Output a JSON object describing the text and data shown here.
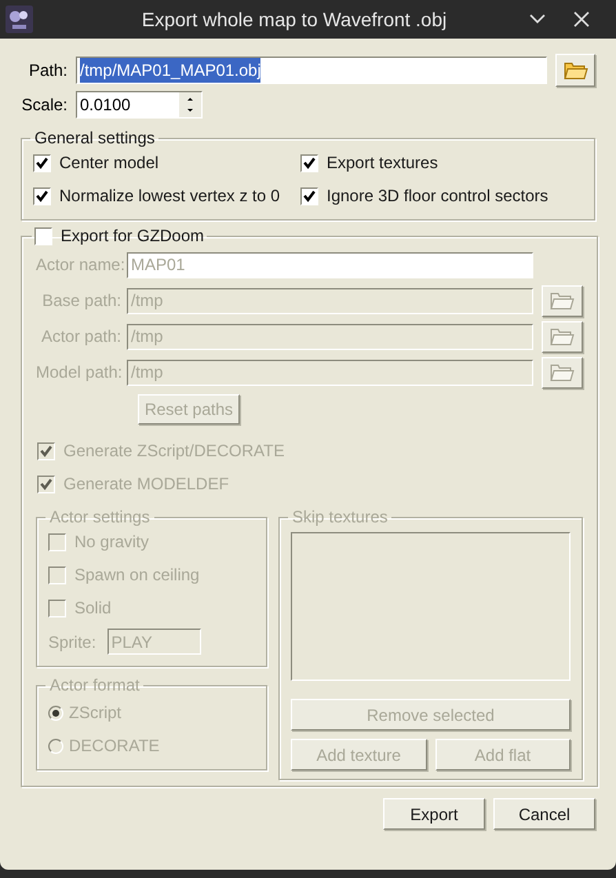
{
  "window": {
    "title": "Export whole map to Wavefront .obj"
  },
  "path": {
    "label": "Path:",
    "value": "/tmp/MAP01_MAP01.obj",
    "selected": true
  },
  "scale": {
    "label": "Scale:",
    "value": "0.0100"
  },
  "general_settings": {
    "title": "General settings",
    "options": [
      {
        "label": "Center model",
        "checked": true
      },
      {
        "label": "Export textures",
        "checked": true
      },
      {
        "label": "Normalize lowest vertex z to 0",
        "checked": true
      },
      {
        "label": "Ignore 3D floor control sectors",
        "checked": true
      }
    ]
  },
  "gzdoom": {
    "label": "Export for GZDoom",
    "checked": false,
    "fields": [
      {
        "label": "Actor name:",
        "value": "MAP01",
        "kind": "text"
      },
      {
        "label": "Base path:",
        "value": "/tmp",
        "kind": "path"
      },
      {
        "label": "Actor path:",
        "value": "/tmp",
        "kind": "path"
      },
      {
        "label": "Model path:",
        "value": "/tmp",
        "kind": "path"
      }
    ],
    "reset_button": "Reset paths",
    "generate": [
      {
        "label": "Generate ZScript/DECORATE",
        "checked": true
      },
      {
        "label": "Generate MODELDEF",
        "checked": true
      }
    ],
    "actor_settings": {
      "title": "Actor settings",
      "options": [
        {
          "label": "No gravity",
          "checked": false
        },
        {
          "label": "Spawn on ceiling",
          "checked": false
        },
        {
          "label": "Solid",
          "checked": false
        }
      ],
      "sprite": {
        "label": "Sprite:",
        "value": "PLAY"
      }
    },
    "actor_format": {
      "title": "Actor format",
      "options": [
        {
          "label": "ZScript",
          "selected": true
        },
        {
          "label": "DECORATE",
          "selected": false
        }
      ]
    },
    "skip_textures": {
      "title": "Skip textures",
      "remove_button": "Remove selected",
      "add_texture_button": "Add texture",
      "add_flat_button": "Add flat"
    }
  },
  "buttons": [
    "Export",
    "Cancel"
  ]
}
